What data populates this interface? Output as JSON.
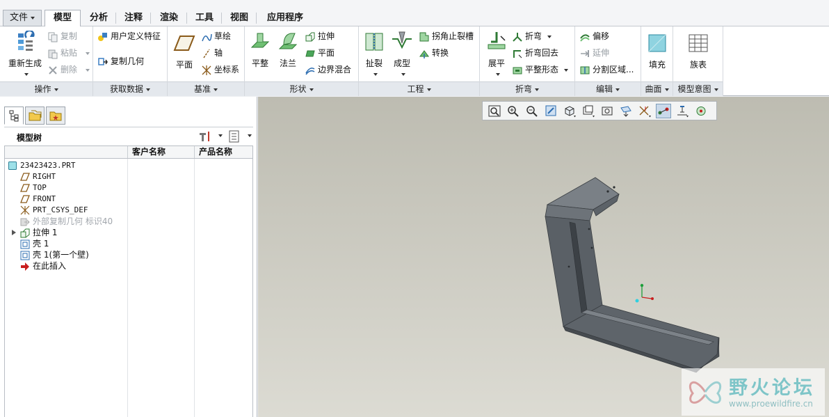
{
  "tabs": [
    {
      "label": "文件"
    },
    {
      "label": "模型"
    },
    {
      "label": "分析"
    },
    {
      "label": "注释"
    },
    {
      "label": "渲染"
    },
    {
      "label": "工具"
    },
    {
      "label": "视图"
    },
    {
      "label": "应用程序"
    }
  ],
  "groups": {
    "operations": {
      "label": "操作",
      "regenerate": "重新生成",
      "copy": "复制",
      "paste": "粘贴",
      "delete": "删除"
    },
    "get_data": {
      "label": "获取数据",
      "udf": "用户定义特征",
      "copy_geom": "复制几何"
    },
    "datum": {
      "label": "基准",
      "plane": "平面",
      "sketch": "草绘",
      "axis": "轴",
      "csys": "坐标系"
    },
    "shapes": {
      "label": "形状",
      "flat": "平整",
      "flange": "法兰",
      "extrude": "拉伸",
      "planar": "平面",
      "blend": "边界混合"
    },
    "engineering": {
      "label": "工程",
      "rip": "扯裂",
      "form": "成型",
      "corner_relief": "拐角止裂槽",
      "convert": "转换"
    },
    "bends": {
      "label": "折弯",
      "unbend": "展平",
      "bend": "折弯",
      "bend_back": "折弯回去",
      "flatten": "平整形态"
    },
    "editing": {
      "label": "编辑",
      "offset": "偏移",
      "extend": "延伸",
      "split": "分割区域..."
    },
    "surfaces": {
      "label": "曲面",
      "fill": "填充"
    },
    "intent": {
      "label": "模型意图",
      "family_table": "族表"
    }
  },
  "tree": {
    "title": "模型树",
    "columns": [
      "客户名称",
      "产品名称"
    ],
    "nodes": [
      {
        "label": "23423423.PRT"
      },
      {
        "label": "RIGHT"
      },
      {
        "label": "TOP"
      },
      {
        "label": "FRONT"
      },
      {
        "label": "PRT_CSYS_DEF"
      },
      {
        "label": "外部复制几何  标识40"
      },
      {
        "label": "拉伸 1"
      },
      {
        "label": "壳 1"
      },
      {
        "label": "壳 1(第一个壁)"
      },
      {
        "label": "在此插入"
      }
    ]
  },
  "watermark": {
    "title": "野火论坛",
    "url": "www.proewildfire.cn"
  },
  "colors": {
    "accent_blue": "#2b6cb0",
    "feature_green": "#3c9a48",
    "model_gray": "#545a60",
    "insert_red": "#c81e1e"
  }
}
